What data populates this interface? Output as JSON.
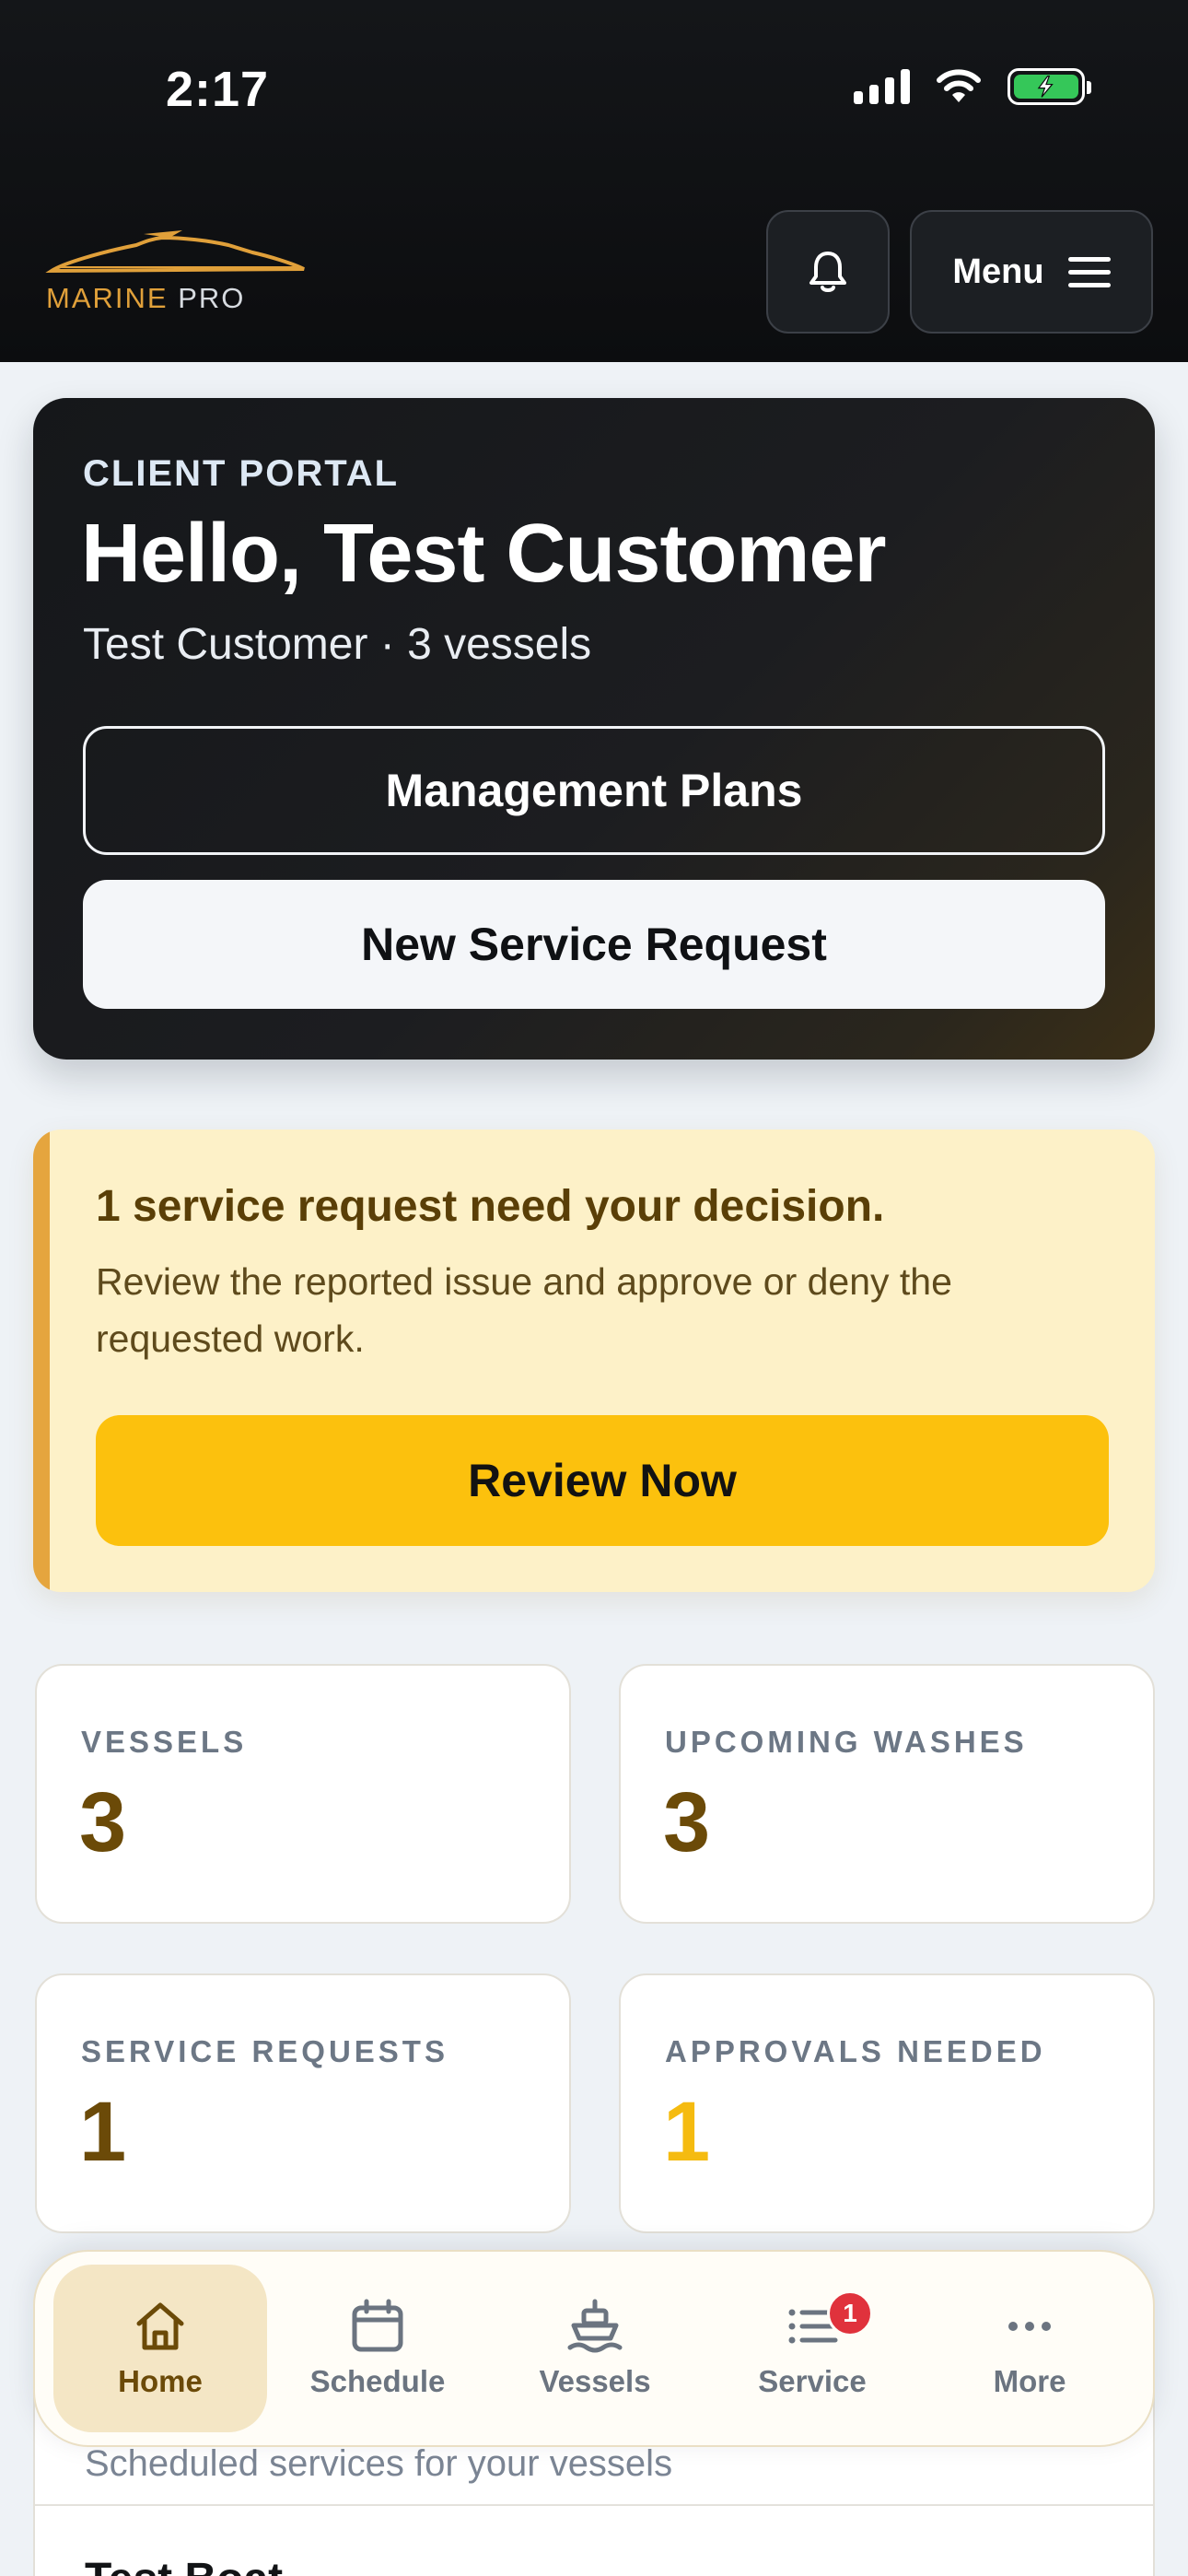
{
  "status_bar": {
    "time": "2:17"
  },
  "brand": {
    "logo_part1": "MARINE",
    "logo_part2": "PRO"
  },
  "header": {
    "menu_label": "Menu"
  },
  "hero": {
    "eyebrow": "CLIENT PORTAL",
    "title": "Hello, Test Customer",
    "subtitle": "Test Customer · 3 vessels",
    "management_plans_label": "Management Plans",
    "new_service_request_label": "New Service Request"
  },
  "alert": {
    "title": "1 service request need your decision.",
    "body": "Review the reported issue and approve or deny the requested work.",
    "review_button_label": "Review Now"
  },
  "stats": [
    {
      "label": "VESSELS",
      "value": "3"
    },
    {
      "label": "UPCOMING WASHES",
      "value": "3"
    },
    {
      "label": "SERVICE REQUESTS",
      "value": "1"
    },
    {
      "label": "APPROVALS NEEDED",
      "value": "1"
    }
  ],
  "upcoming_section": {
    "subtitle": "Scheduled services for your vessels",
    "first_item_title": "Test Boat"
  },
  "bottom_nav": {
    "items": [
      {
        "label": "Home",
        "icon": "home-icon",
        "active": true
      },
      {
        "label": "Schedule",
        "icon": "calendar-icon"
      },
      {
        "label": "Vessels",
        "icon": "boat-icon"
      },
      {
        "label": "Service",
        "icon": "list-icon",
        "badge": "1"
      },
      {
        "label": "More",
        "icon": "more-icon"
      }
    ]
  },
  "colors": {
    "accent_brown": "#6b4a08",
    "accent_yellow": "#fcc10d",
    "alert_background": "#fdf1c8",
    "alert_stripe": "#e5a53e",
    "badge_red": "#e0323c",
    "battery_green": "#35c759"
  }
}
